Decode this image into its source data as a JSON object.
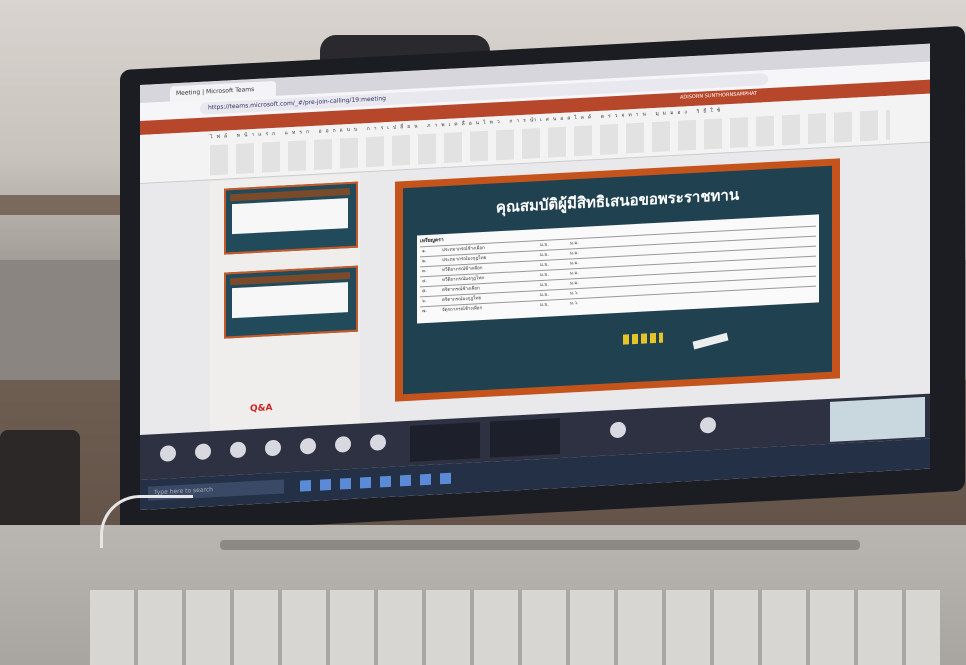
{
  "browser": {
    "tab_label": "Meeting | Microsoft Teams",
    "url": "https://teams.microsoft.com/_#/pre-join-calling/19:meeting"
  },
  "powerpoint": {
    "user_name": "ADISORN SUNTHORNSAMPHAT",
    "ribbon_tabs": "ไฟล์ หน้าแรก แทรก ออกแบบ การเปลี่ยน ภาพเคลื่อนไหว การนำเสนอสไลด์ ตรวจทาน มุมมอง วิธีใช้"
  },
  "slide": {
    "title": "คุณสมบัติผู้มีสิทธิเสนอขอพระราชทาน",
    "table_heading": "เหรียญตรา",
    "rows": [
      {
        "no": "๑.",
        "name": "ประถมาภรณ์ช้างเผือก",
        "col1": "ม.ม.",
        "col2": "ม.ม."
      },
      {
        "no": "๒.",
        "name": "ประถมาภรณ์มงกุฎไทย",
        "col1": "ม.ม.",
        "col2": "ม.ม."
      },
      {
        "no": "๓.",
        "name": "ทวีติยาภรณ์ช้างเผือก",
        "col1": "ม.ม.",
        "col2": "ม.ม."
      },
      {
        "no": "๔.",
        "name": "ทวีติยาภรณ์มงกุฎไทย",
        "col1": "ม.ม.",
        "col2": "ม.ม."
      },
      {
        "no": "๕.",
        "name": "ตริตาภรณ์ช้างเผือก",
        "col1": "ม.ม.",
        "col2": "ม.ม."
      },
      {
        "no": "๖.",
        "name": "ตริตาภรณ์มงกุฎไทย",
        "col1": "ม.ม.",
        "col2": "ม.ว."
      },
      {
        "no": "๗.",
        "name": "จัตุรถาภรณ์ช้างเผือก",
        "col1": "ม.ม.",
        "col2": "ม.ว."
      }
    ]
  },
  "panel": {
    "qa_label": "Q&A"
  },
  "taskbar": {
    "search_placeholder": "Type here to search"
  }
}
